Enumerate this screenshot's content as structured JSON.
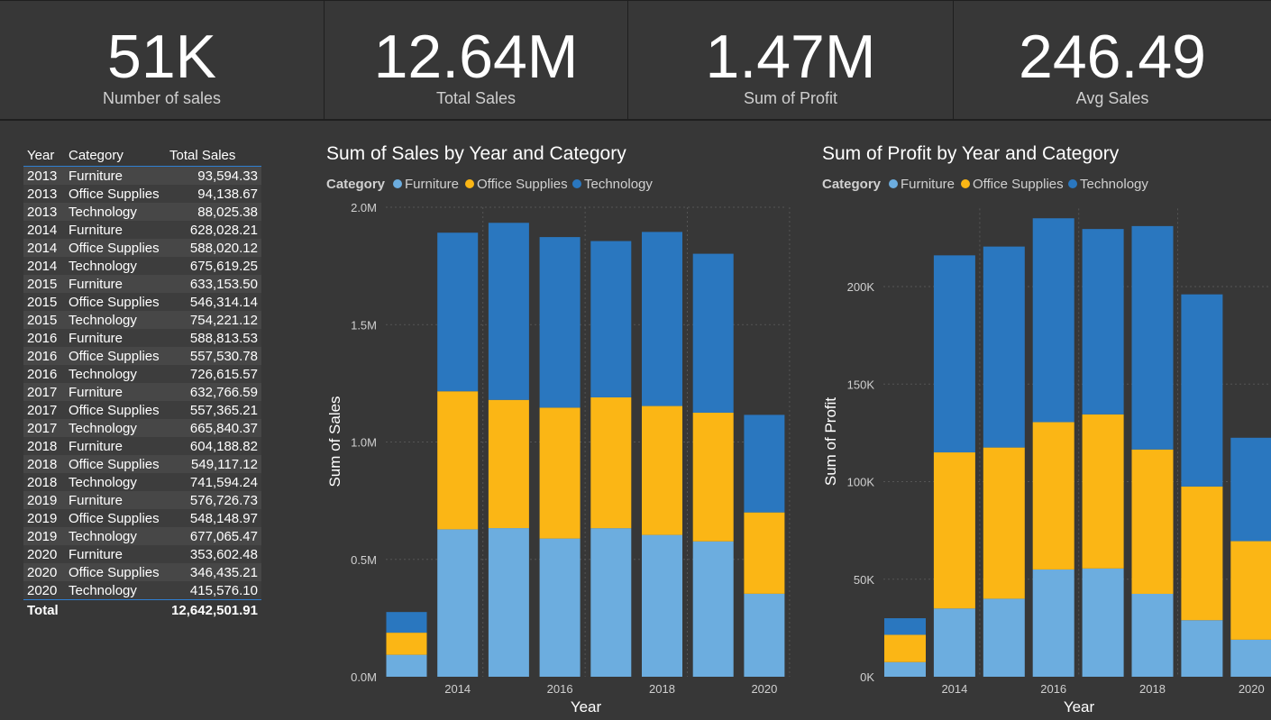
{
  "kpis": [
    {
      "value": "51K",
      "label": "Number of sales"
    },
    {
      "value": "12.64M",
      "label": "Total Sales"
    },
    {
      "value": "1.47M",
      "label": "Sum of Profit"
    },
    {
      "value": "246.49",
      "label": "Avg Sales"
    }
  ],
  "table": {
    "headers": [
      "Year",
      "Category",
      "Total Sales"
    ],
    "rows": [
      [
        "2013",
        "Furniture",
        "93,594.33"
      ],
      [
        "2013",
        "Office Supplies",
        "94,138.67"
      ],
      [
        "2013",
        "Technology",
        "88,025.38"
      ],
      [
        "2014",
        "Furniture",
        "628,028.21"
      ],
      [
        "2014",
        "Office Supplies",
        "588,020.12"
      ],
      [
        "2014",
        "Technology",
        "675,619.25"
      ],
      [
        "2015",
        "Furniture",
        "633,153.50"
      ],
      [
        "2015",
        "Office Supplies",
        "546,314.14"
      ],
      [
        "2015",
        "Technology",
        "754,221.12"
      ],
      [
        "2016",
        "Furniture",
        "588,813.53"
      ],
      [
        "2016",
        "Office Supplies",
        "557,530.78"
      ],
      [
        "2016",
        "Technology",
        "726,615.57"
      ],
      [
        "2017",
        "Furniture",
        "632,766.59"
      ],
      [
        "2017",
        "Office Supplies",
        "557,365.21"
      ],
      [
        "2017",
        "Technology",
        "665,840.37"
      ],
      [
        "2018",
        "Furniture",
        "604,188.82"
      ],
      [
        "2018",
        "Office Supplies",
        "549,117.12"
      ],
      [
        "2018",
        "Technology",
        "741,594.24"
      ],
      [
        "2019",
        "Furniture",
        "576,726.73"
      ],
      [
        "2019",
        "Office Supplies",
        "548,148.97"
      ],
      [
        "2019",
        "Technology",
        "677,065.47"
      ],
      [
        "2020",
        "Furniture",
        "353,602.48"
      ],
      [
        "2020",
        "Office Supplies",
        "346,435.21"
      ],
      [
        "2020",
        "Technology",
        "415,576.10"
      ]
    ],
    "total_label": "Total",
    "total_value": "12,642,501.91"
  },
  "chart_data": [
    {
      "type": "bar",
      "stacked": true,
      "title": "Sum of Sales by Year and Category",
      "legend_title": "Category",
      "legend_position": "top-left",
      "xlabel": "Year",
      "ylabel": "Sum of Sales",
      "categories": [
        2013,
        2014,
        2015,
        2016,
        2017,
        2018,
        2019,
        2020
      ],
      "x_tick_labels": [
        "2014",
        "2016",
        "2018",
        "2020"
      ],
      "ylim": [
        0,
        2000000
      ],
      "y_ticks": [
        0,
        500000,
        1000000,
        1500000,
        2000000
      ],
      "y_tick_labels": [
        "0.0M",
        "0.5M",
        "1.0M",
        "1.5M",
        "2.0M"
      ],
      "grid": true,
      "series": [
        {
          "name": "Furniture",
          "color": "#6caddf",
          "values": [
            93594,
            628028,
            633154,
            588814,
            632767,
            604189,
            576727,
            353602
          ]
        },
        {
          "name": "Office Supplies",
          "color": "#fbb615",
          "values": [
            94139,
            588020,
            546314,
            557531,
            557365,
            549117,
            548149,
            346435
          ]
        },
        {
          "name": "Technology",
          "color": "#2a77bf",
          "values": [
            88025,
            675619,
            754221,
            726616,
            665840,
            741594,
            677065,
            415576
          ]
        }
      ]
    },
    {
      "type": "bar",
      "stacked": true,
      "title": "Sum of Profit by Year and Category",
      "legend_title": "Category",
      "legend_position": "top-left",
      "xlabel": "Year",
      "ylabel": "Sum of Profit",
      "categories": [
        2013,
        2014,
        2015,
        2016,
        2017,
        2018,
        2019,
        2020
      ],
      "x_tick_labels": [
        "2014",
        "2016",
        "2018",
        "2020"
      ],
      "ylim": [
        0,
        240000
      ],
      "y_ticks": [
        0,
        50000,
        100000,
        150000,
        200000
      ],
      "y_tick_labels": [
        "0K",
        "50K",
        "100K",
        "150K",
        "200K"
      ],
      "grid": true,
      "series": [
        {
          "name": "Furniture",
          "color": "#6caddf",
          "values": [
            7500,
            35000,
            40000,
            55000,
            55500,
            42500,
            29000,
            19000
          ]
        },
        {
          "name": "Office Supplies",
          "color": "#fbb615",
          "values": [
            14000,
            80000,
            77500,
            75500,
            79000,
            74000,
            68500,
            50500
          ]
        },
        {
          "name": "Technology",
          "color": "#2a77bf",
          "values": [
            8500,
            101000,
            103000,
            104500,
            95000,
            114500,
            98500,
            53000
          ]
        }
      ]
    }
  ]
}
